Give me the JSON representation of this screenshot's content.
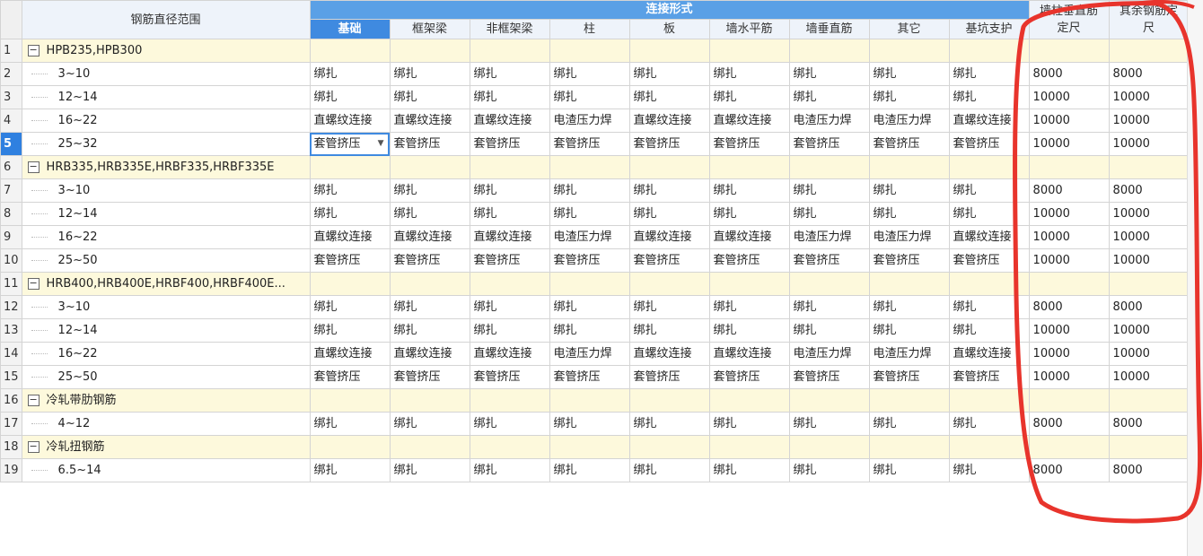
{
  "header": {
    "range_label": "钢筋直径范围",
    "group_label": "连接形式",
    "columns": [
      "基础",
      "框架梁",
      "非框架梁",
      "柱",
      "板",
      "墙水平筋",
      "墙垂直筋",
      "其它",
      "基坑支护"
    ],
    "col_wall": [
      "墙柱垂直筋",
      "定尺"
    ],
    "col_other": [
      "其余钢筋定",
      "尺"
    ]
  },
  "rows": [
    {
      "no": "1",
      "group": true,
      "label": "HPB235,HPB300"
    },
    {
      "no": "2",
      "label": "3~10",
      "cells": [
        "绑扎",
        "绑扎",
        "绑扎",
        "绑扎",
        "绑扎",
        "绑扎",
        "绑扎",
        "绑扎",
        "绑扎",
        "8000",
        "8000"
      ]
    },
    {
      "no": "3",
      "label": "12~14",
      "cells": [
        "绑扎",
        "绑扎",
        "绑扎",
        "绑扎",
        "绑扎",
        "绑扎",
        "绑扎",
        "绑扎",
        "绑扎",
        "10000",
        "10000"
      ]
    },
    {
      "no": "4",
      "label": "16~22",
      "cells": [
        "直螺纹连接",
        "直螺纹连接",
        "直螺纹连接",
        "电渣压力焊",
        "直螺纹连接",
        "直螺纹连接",
        "电渣压力焊",
        "电渣压力焊",
        "直螺纹连接",
        "10000",
        "10000"
      ]
    },
    {
      "no": "5",
      "label": "25~32",
      "active": true,
      "cells": [
        "套管挤压",
        "套管挤压",
        "套管挤压",
        "套管挤压",
        "套管挤压",
        "套管挤压",
        "套管挤压",
        "套管挤压",
        "套管挤压",
        "10000",
        "10000"
      ]
    },
    {
      "no": "6",
      "group": true,
      "label": "HRB335,HRB335E,HRBF335,HRBF335E"
    },
    {
      "no": "7",
      "label": "3~10",
      "cells": [
        "绑扎",
        "绑扎",
        "绑扎",
        "绑扎",
        "绑扎",
        "绑扎",
        "绑扎",
        "绑扎",
        "绑扎",
        "8000",
        "8000"
      ]
    },
    {
      "no": "8",
      "label": "12~14",
      "cells": [
        "绑扎",
        "绑扎",
        "绑扎",
        "绑扎",
        "绑扎",
        "绑扎",
        "绑扎",
        "绑扎",
        "绑扎",
        "10000",
        "10000"
      ]
    },
    {
      "no": "9",
      "label": "16~22",
      "cells": [
        "直螺纹连接",
        "直螺纹连接",
        "直螺纹连接",
        "电渣压力焊",
        "直螺纹连接",
        "直螺纹连接",
        "电渣压力焊",
        "电渣压力焊",
        "直螺纹连接",
        "10000",
        "10000"
      ]
    },
    {
      "no": "10",
      "label": "25~50",
      "cells": [
        "套管挤压",
        "套管挤压",
        "套管挤压",
        "套管挤压",
        "套管挤压",
        "套管挤压",
        "套管挤压",
        "套管挤压",
        "套管挤压",
        "10000",
        "10000"
      ]
    },
    {
      "no": "11",
      "group": true,
      "label": "HRB400,HRB400E,HRBF400,HRBF400E..."
    },
    {
      "no": "12",
      "label": "3~10",
      "cells": [
        "绑扎",
        "绑扎",
        "绑扎",
        "绑扎",
        "绑扎",
        "绑扎",
        "绑扎",
        "绑扎",
        "绑扎",
        "8000",
        "8000"
      ]
    },
    {
      "no": "13",
      "label": "12~14",
      "cells": [
        "绑扎",
        "绑扎",
        "绑扎",
        "绑扎",
        "绑扎",
        "绑扎",
        "绑扎",
        "绑扎",
        "绑扎",
        "10000",
        "10000"
      ]
    },
    {
      "no": "14",
      "label": "16~22",
      "cells": [
        "直螺纹连接",
        "直螺纹连接",
        "直螺纹连接",
        "电渣压力焊",
        "直螺纹连接",
        "直螺纹连接",
        "电渣压力焊",
        "电渣压力焊",
        "直螺纹连接",
        "10000",
        "10000"
      ]
    },
    {
      "no": "15",
      "label": "25~50",
      "cells": [
        "套管挤压",
        "套管挤压",
        "套管挤压",
        "套管挤压",
        "套管挤压",
        "套管挤压",
        "套管挤压",
        "套管挤压",
        "套管挤压",
        "10000",
        "10000"
      ]
    },
    {
      "no": "16",
      "group": true,
      "label": "冷轧带肋钢筋"
    },
    {
      "no": "17",
      "label": "4~12",
      "cells": [
        "绑扎",
        "绑扎",
        "绑扎",
        "绑扎",
        "绑扎",
        "绑扎",
        "绑扎",
        "绑扎",
        "绑扎",
        "8000",
        "8000"
      ]
    },
    {
      "no": "18",
      "group": true,
      "label": "冷轧扭钢筋"
    },
    {
      "no": "19",
      "label": "6.5~14",
      "cells": [
        "绑扎",
        "绑扎",
        "绑扎",
        "绑扎",
        "绑扎",
        "绑扎",
        "绑扎",
        "绑扎",
        "绑扎",
        "8000",
        "8000"
      ]
    }
  ],
  "annotation": {
    "color": "#e8342c"
  }
}
